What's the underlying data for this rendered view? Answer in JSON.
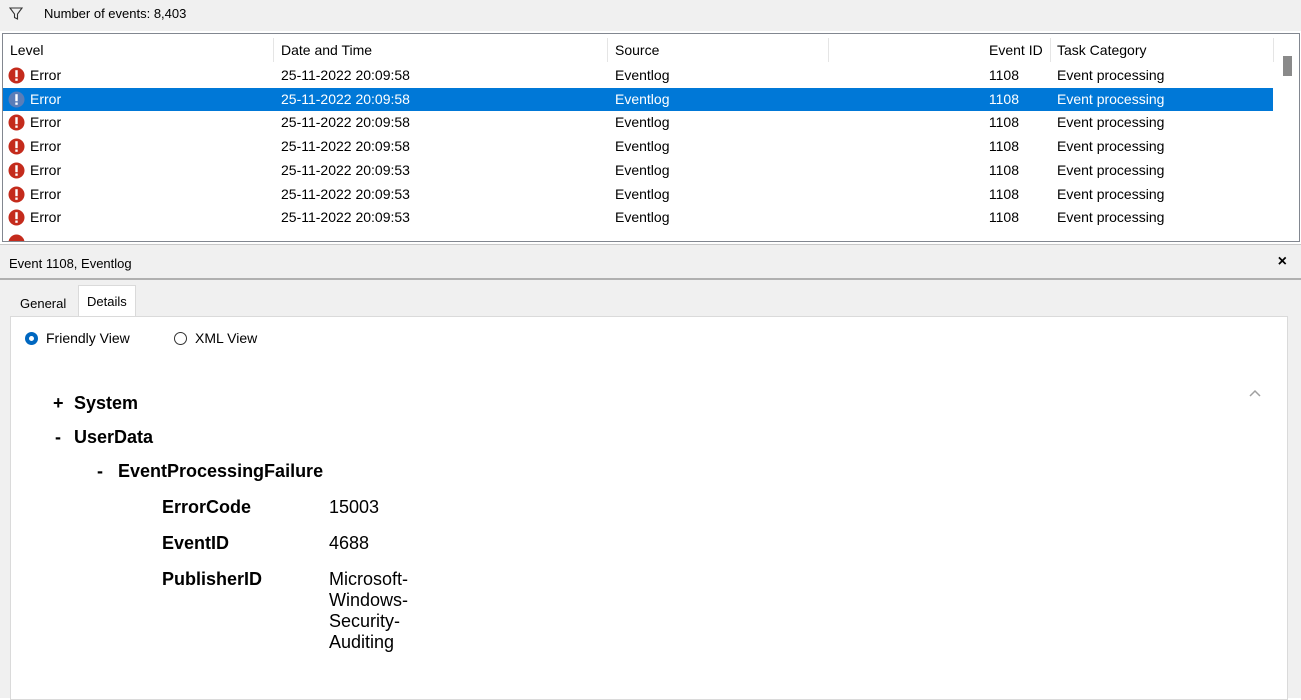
{
  "toolbar": {
    "events_count_label": "Number of events: 8,403",
    "filter_icon": "filter-icon"
  },
  "columns": [
    "Level",
    "Date and Time",
    "Source",
    "Event ID",
    "Task Category"
  ],
  "rows": [
    {
      "level": "Error",
      "datetime": "25-11-2022 20:09:58",
      "source": "Eventlog",
      "event_id": "1108",
      "category": "Event processing",
      "selected": false
    },
    {
      "level": "Error",
      "datetime": "25-11-2022 20:09:58",
      "source": "Eventlog",
      "event_id": "1108",
      "category": "Event processing",
      "selected": true
    },
    {
      "level": "Error",
      "datetime": "25-11-2022 20:09:58",
      "source": "Eventlog",
      "event_id": "1108",
      "category": "Event processing",
      "selected": false
    },
    {
      "level": "Error",
      "datetime": "25-11-2022 20:09:58",
      "source": "Eventlog",
      "event_id": "1108",
      "category": "Event processing",
      "selected": false
    },
    {
      "level": "Error",
      "datetime": "25-11-2022 20:09:53",
      "source": "Eventlog",
      "event_id": "1108",
      "category": "Event processing",
      "selected": false
    },
    {
      "level": "Error",
      "datetime": "25-11-2022 20:09:53",
      "source": "Eventlog",
      "event_id": "1108",
      "category": "Event processing",
      "selected": false
    },
    {
      "level": "Error",
      "datetime": "25-11-2022 20:09:53",
      "source": "Eventlog",
      "event_id": "1108",
      "category": "Event processing",
      "selected": false
    }
  ],
  "detail": {
    "title": "Event 1108, Eventlog",
    "close_glyph": "×",
    "tabs": [
      "General",
      "Details"
    ],
    "active_tab": "Details",
    "views": {
      "friendly": "Friendly View",
      "xml": "XML View",
      "selected": "Friendly View"
    },
    "tree": {
      "system_sign": "+",
      "system": "System",
      "userdata_sign": "-",
      "userdata": "UserData",
      "epf_sign": "-",
      "epf": "EventProcessingFailure",
      "fields": [
        {
          "key": "ErrorCode",
          "value": "15003"
        },
        {
          "key": "EventID",
          "value": "4688"
        },
        {
          "key": "PublisherID",
          "value": "Microsoft-Windows-Security-Auditing"
        }
      ]
    }
  },
  "colors": {
    "selection": "#0078d7",
    "error_icon": "#c42b1c",
    "radio_accent": "#0067c0"
  }
}
